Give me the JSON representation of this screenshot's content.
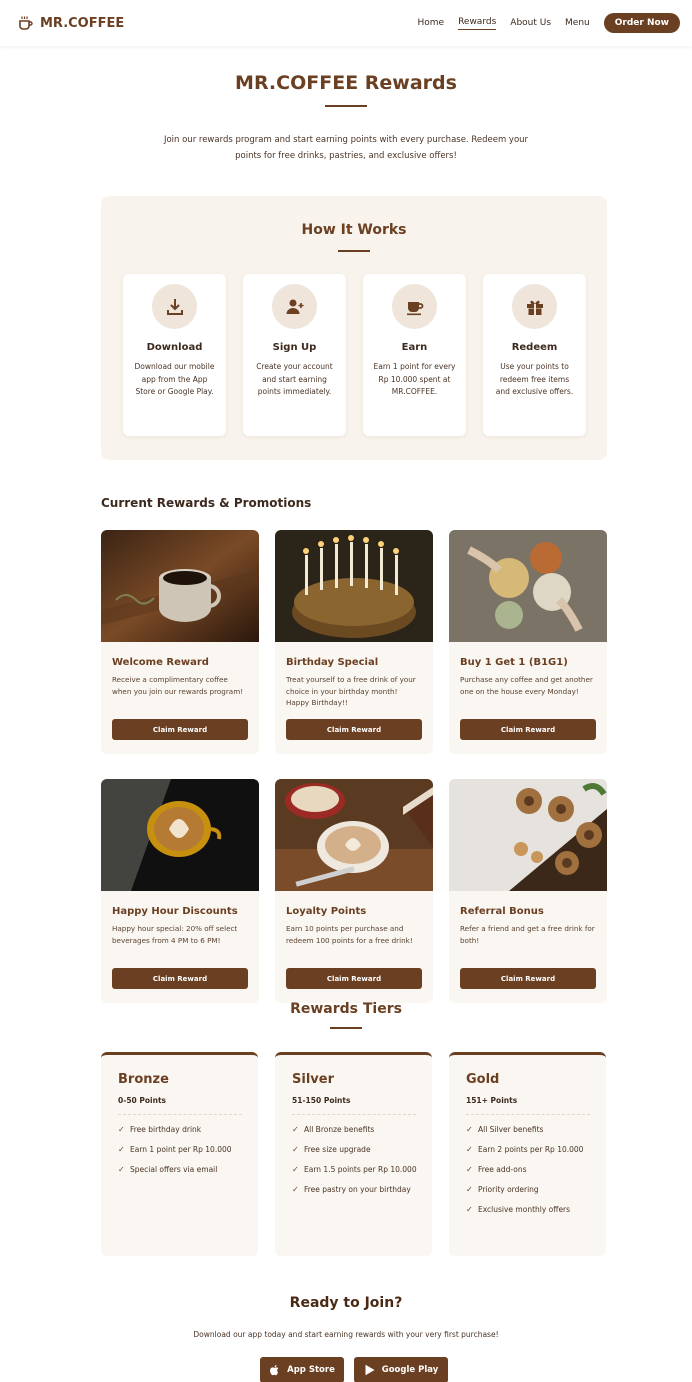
{
  "header": {
    "logo_text": "MR.COFFEE",
    "nav": [
      "Home",
      "Rewards",
      "About Us",
      "Menu"
    ],
    "active_nav": "Rewards",
    "order_button": "Order Now"
  },
  "hero": {
    "title": "MR.COFFEE Rewards",
    "intro": "Join our rewards program and start earning points with every purchase. Redeem your points for free drinks, pastries, and exclusive offers!"
  },
  "how_it_works": {
    "title": "How It Works",
    "steps": [
      {
        "icon": "download-icon",
        "title": "Download",
        "desc": "Download our mobile app from the App Store or Google Play."
      },
      {
        "icon": "user-plus-icon",
        "title": "Sign Up",
        "desc": "Create your account and start earning points immediately."
      },
      {
        "icon": "coffee-cup-icon",
        "title": "Earn",
        "desc": "Earn 1 point for every Rp 10.000 spent at MR.COFFEE."
      },
      {
        "icon": "gift-icon",
        "title": "Redeem",
        "desc": "Use your points to redeem free items and exclusive offers."
      }
    ]
  },
  "promotions": {
    "title": "Current Rewards & Promotions",
    "claim_label": "Claim Reward",
    "cards": [
      {
        "title": "Welcome Reward",
        "desc": "Receive a complimentary coffee when you join our rewards program!"
      },
      {
        "title": "Birthday Special",
        "desc": "Treat yourself to a free drink of your choice in your birthday month! Happy Birthday!!"
      },
      {
        "title": "Buy 1 Get 1 (B1G1)",
        "desc": "Purchase any coffee and get another one on the house every Monday!"
      },
      {
        "title": "Happy Hour Discounts",
        "desc": "Happy hour special: 20% off select beverages from 4 PM to 6 PM!"
      },
      {
        "title": "Loyalty Points",
        "desc": "Earn 10 points per purchase and redeem 100 points for a free drink!"
      },
      {
        "title": "Referral Bonus",
        "desc": "Refer a friend and get a free drink for both!"
      }
    ]
  },
  "tiers": {
    "title": "Rewards Tiers",
    "items": [
      {
        "name": "Bronze",
        "points": "0-50 Points",
        "benefits": [
          "Free birthday drink",
          "Earn 1 point per Rp 10.000",
          "Special offers via email"
        ]
      },
      {
        "name": "Silver",
        "points": "51-150 Points",
        "benefits": [
          "All Bronze benefits",
          "Free size upgrade",
          "Earn 1.5 points per Rp 10.000",
          "Free pastry on your birthday"
        ]
      },
      {
        "name": "Gold",
        "points": "151+ Points",
        "benefits": [
          "All Silver benefits",
          "Earn 2 points per Rp 10.000",
          "Free add-ons",
          "Priority ordering",
          "Exclusive monthly offers"
        ]
      }
    ]
  },
  "join": {
    "title": "Ready to Join?",
    "text": "Download our app today and start earning rewards with your very first purchase!",
    "app_store": "App Store",
    "google_play": "Google Play"
  },
  "colors": {
    "brand": "#6b3f22",
    "panel": "#f8f3ec",
    "card": "#faf6f1"
  }
}
